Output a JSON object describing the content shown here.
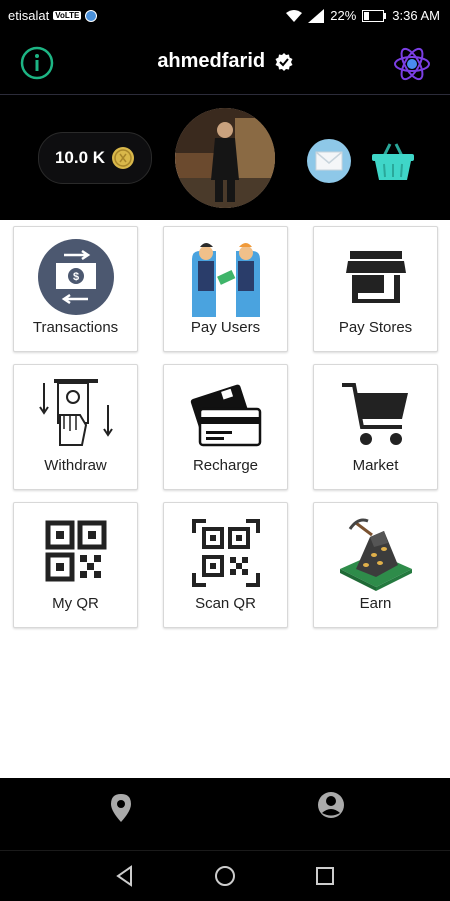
{
  "status_bar": {
    "carrier": "etisalat",
    "volte": "VoLTE",
    "battery": "22%",
    "time": "3:36 AM"
  },
  "header": {
    "username": "ahmedfarid",
    "balance": "10.0 K"
  },
  "tiles": [
    {
      "label": "Transactions",
      "icon": "transactions-icon"
    },
    {
      "label": "Pay Users",
      "icon": "pay-users-icon"
    },
    {
      "label": "Pay Stores",
      "icon": "store-icon"
    },
    {
      "label": "Withdraw",
      "icon": "withdraw-icon"
    },
    {
      "label": "Recharge",
      "icon": "credit-card-icon"
    },
    {
      "label": "Market",
      "icon": "shopping-cart-icon"
    },
    {
      "label": "My QR",
      "icon": "qr-code-icon"
    },
    {
      "label": "Scan QR",
      "icon": "scan-qr-icon"
    },
    {
      "label": "Earn",
      "icon": "mining-icon"
    }
  ],
  "bottom_nav": [
    "location-icon",
    "account-icon"
  ],
  "system_nav": [
    "back-icon",
    "home-icon",
    "recents-icon"
  ],
  "colors": {
    "accent_green": "#1db584",
    "purple": "#7b3fe4",
    "mail_blue": "#8ec8e8",
    "basket_teal": "#3fd6c8"
  }
}
